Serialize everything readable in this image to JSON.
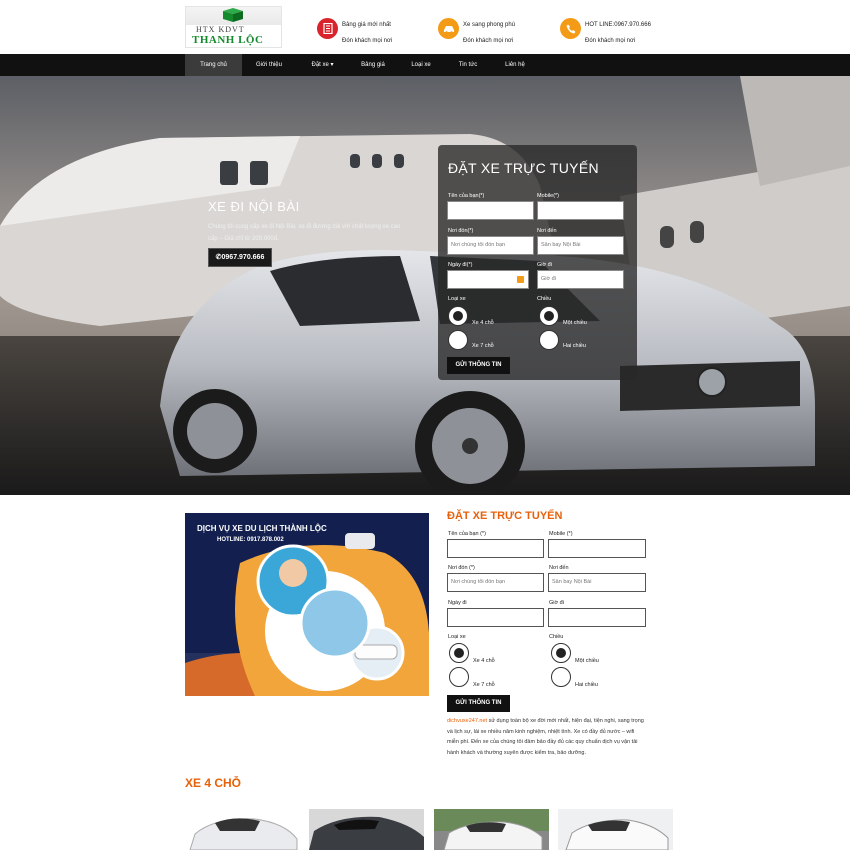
{
  "header": {
    "logo": {
      "line1": "HTX KDVT",
      "line2": "THANH   LỘC"
    },
    "info": [
      {
        "icon": "price-list-icon",
        "color": "#d9232d",
        "title": "Bảng giá mới nhất",
        "sub": "Đón khách mọi nơi"
      },
      {
        "icon": "car-icon",
        "color": "#f39a17",
        "title": "Xe sang phong phú",
        "sub": "Đón khách mọi nơi"
      },
      {
        "icon": "phone-icon",
        "color": "#f39a17",
        "title": "HOT LINE:0967.970.666",
        "sub": "Đón khách mọi nơi"
      }
    ]
  },
  "nav": [
    {
      "label": "Trang chủ",
      "active": true
    },
    {
      "label": "Giới thiệu"
    },
    {
      "label": "Đặt xe ▾"
    },
    {
      "label": "Bảng giá"
    },
    {
      "label": "Loại xe"
    },
    {
      "label": "Tin tức"
    },
    {
      "label": "Liên hệ"
    }
  ],
  "hero": {
    "title": "XE ĐI NỘI BÀI",
    "desc": "Chúng tôi cung cấp xe đi Nội Bài, xe đi đường dài với chất lượng xe cao cấp – Giá chỉ từ 200.000đ.",
    "phone": "0967.970.666"
  },
  "form": {
    "title": "ĐẶT XE TRỰC TUYẾN",
    "name_label": "Tên của bạn(*)",
    "mobile_label": "Mobile(*)",
    "from_label": "Nơi đón(*)",
    "to_label": "Nơi đến",
    "from_placeholder": "Nơi chúng tôi đón bạn",
    "to_placeholder": "Sân bay Nội Bài",
    "date_label": "Ngày đi(*)",
    "time_label": "Giờ đi",
    "time_placeholder": "Giờ đi",
    "type_label": "Loại xe",
    "dir_label": "Chiều",
    "opt_4": "Xe 4 chỗ",
    "opt_7": "Xe 7 chỗ",
    "opt_one": "Một chiều",
    "opt_two": "Hai chiều",
    "submit": "GỬI THÔNG TIN"
  },
  "form2": {
    "title": "ĐẶT XE TRỰC TUYẾN",
    "name_label": "Tên của bạn (*)",
    "mobile_label": "Mobile (*)",
    "from_label": "Nơi đón (*)",
    "to_label": "Nơi đến",
    "from_placeholder": "Nơi chúng tôi đón bạn",
    "to_placeholder": "Sân bay Nội Bài",
    "date_label": "Ngày đi",
    "time_label": "Giờ đi",
    "type_label": "Loại xe",
    "dir_label": "Chiều",
    "opt_4": "Xe 4 chỗ",
    "opt_7": "Xe 7 chỗ",
    "opt_one": "Một chiều",
    "opt_two": "Hai chiều",
    "submit": "GỬI THÔNG TIN"
  },
  "promo": {
    "title": "DỊCH VỤ XE DU LỊCH THÀNH LỘC",
    "hotline": "HOTLINE: 0917.878.002"
  },
  "para": {
    "highlight": "dichvuxe247.net",
    "text": " sử dụng toàn bộ xe đời mới nhất, hiện đại, tiện nghi, sang trọng và lịch sự, lái xe nhiều năm kinh nghiệm, nhiệt tình. Xe có đầy đủ nước – wifi miễn phí. Đến xe của chúng tôi đảm bảo đầy đủ các quy chuẩn dịch vụ vận tải hành khách và thường xuyên được kiểm tra, bảo dưỡng."
  },
  "section": {
    "title": "XE 4 CHỖ"
  },
  "colors": {
    "accent": "#e8610a",
    "nav": "#111111",
    "brand_green": "#148a2c"
  }
}
